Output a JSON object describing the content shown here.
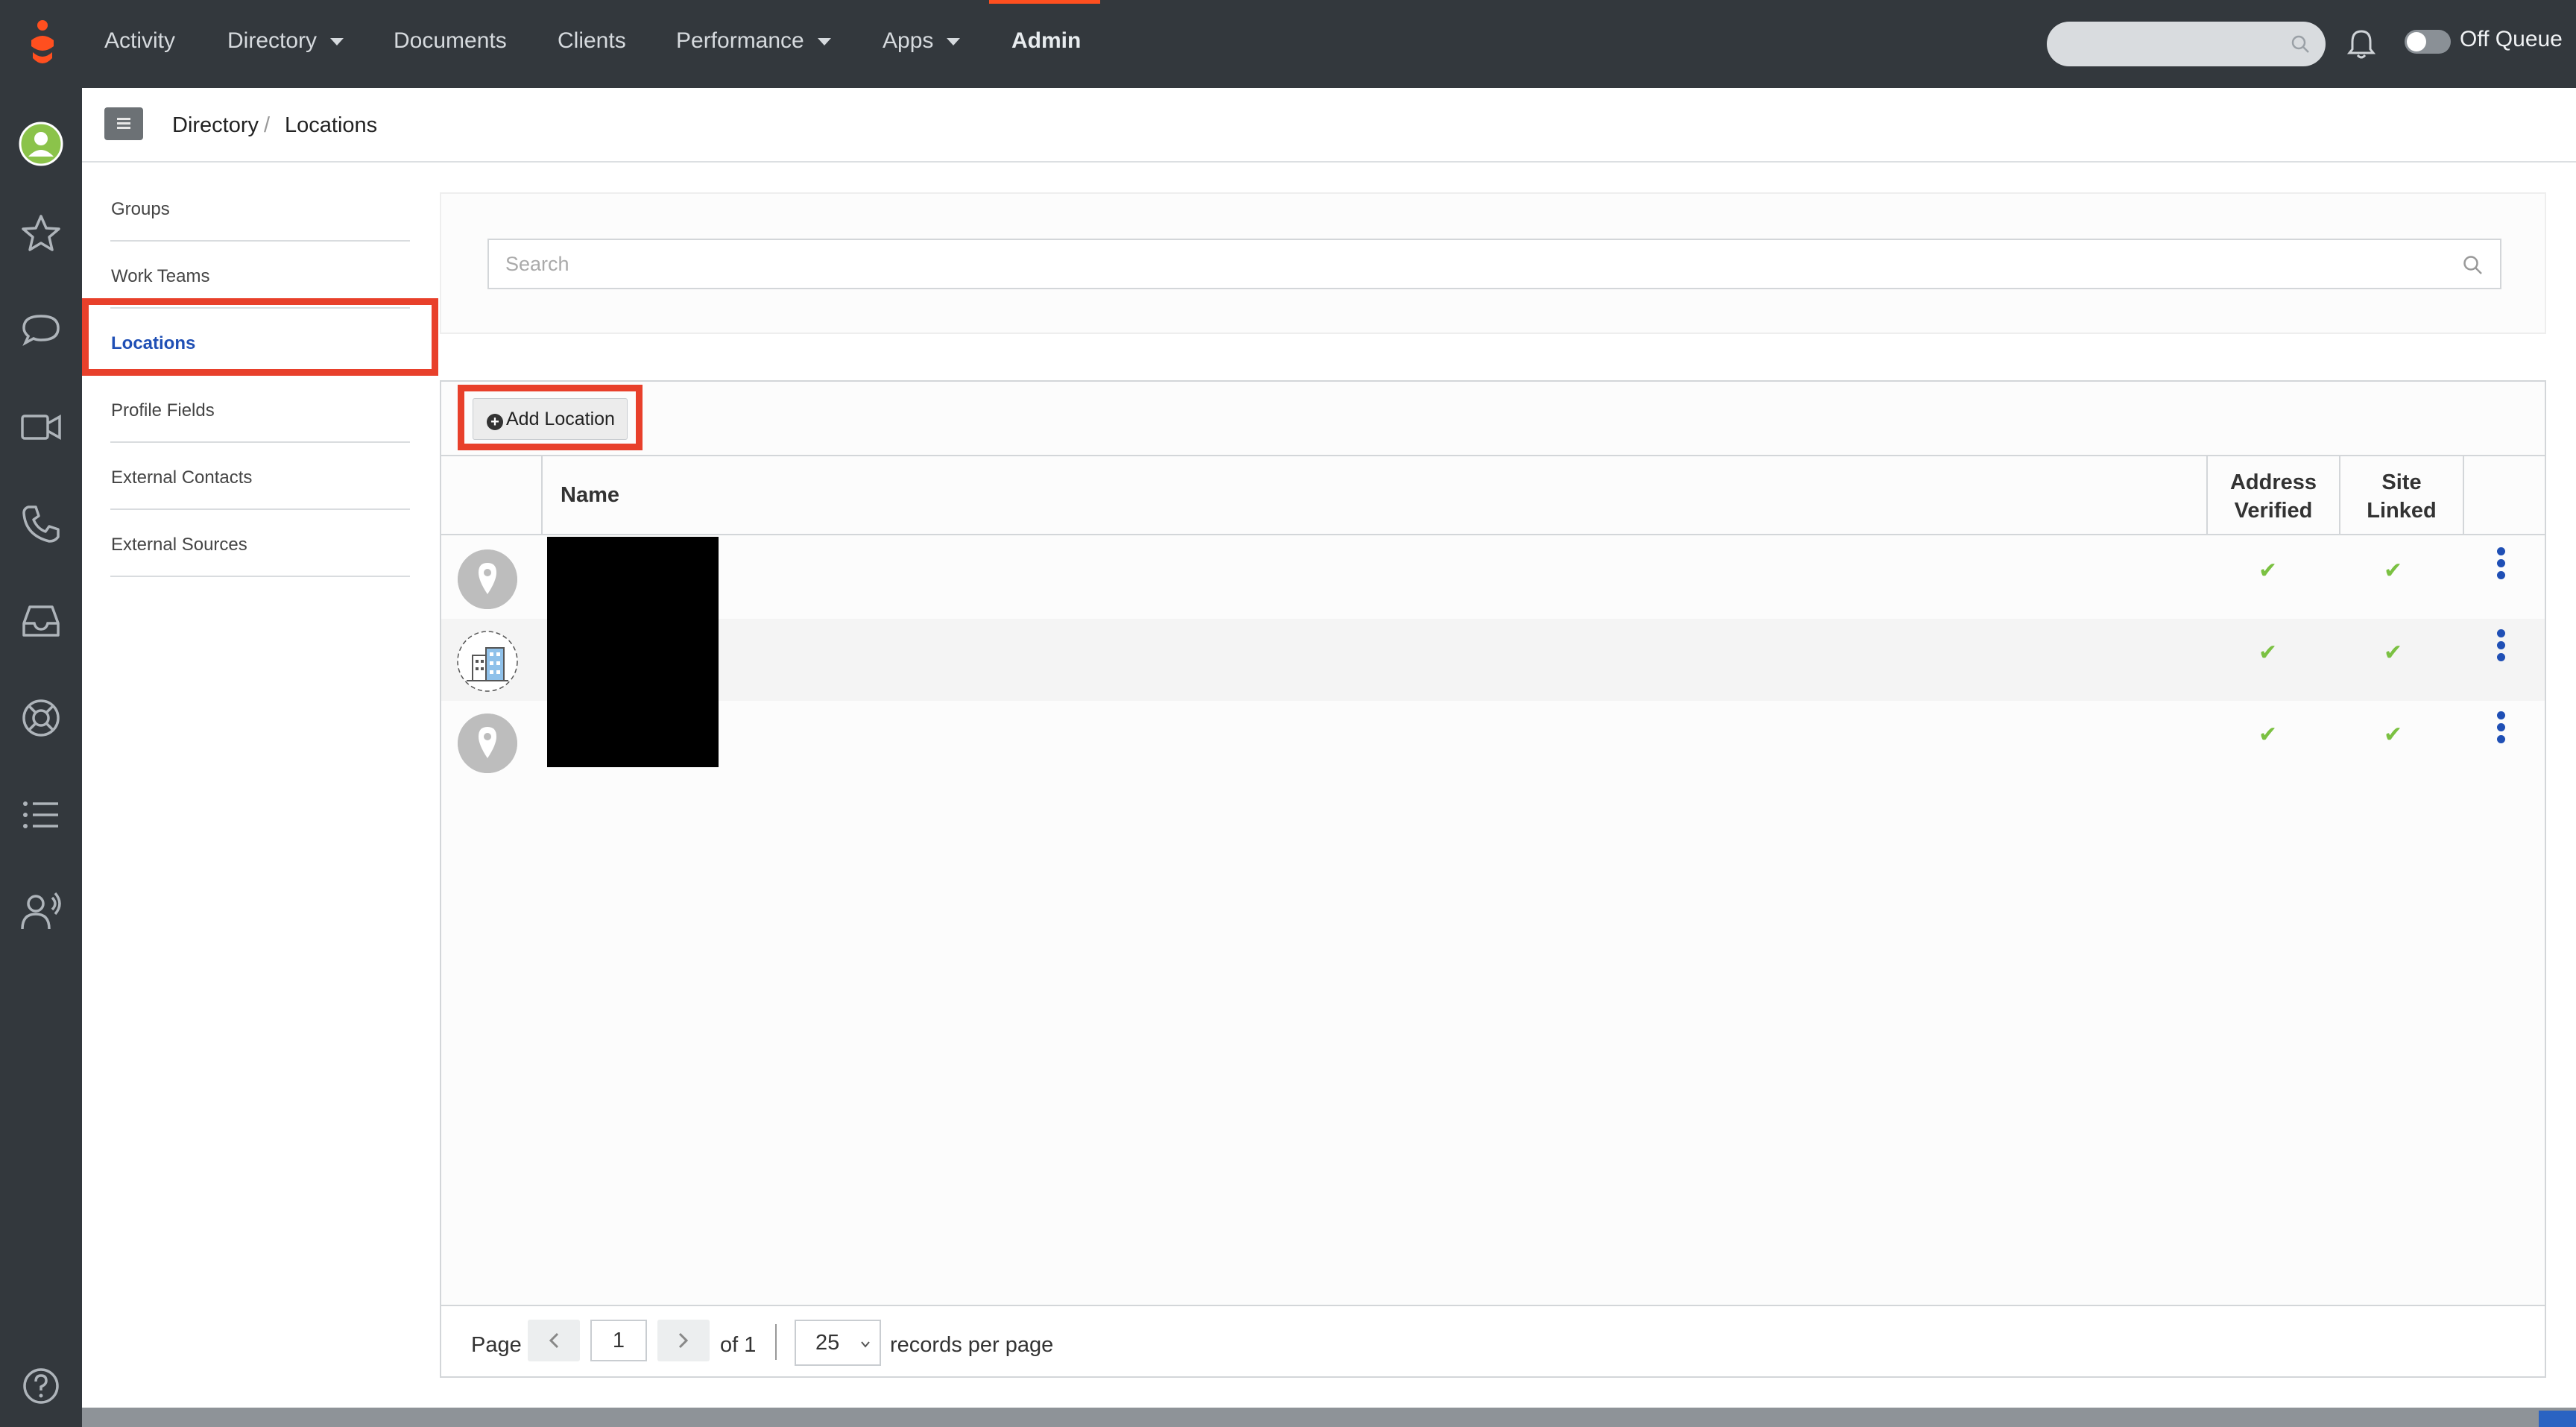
{
  "topnav": {
    "items": [
      {
        "label": "Activity",
        "has_caret": false
      },
      {
        "label": "Directory",
        "has_caret": true
      },
      {
        "label": "Documents",
        "has_caret": false
      },
      {
        "label": "Clients",
        "has_caret": false
      },
      {
        "label": "Performance",
        "has_caret": true
      },
      {
        "label": "Apps",
        "has_caret": true
      },
      {
        "label": "Admin",
        "has_caret": false,
        "active": true
      }
    ],
    "queue_label": "Off Queue",
    "accent_color": "#ff4f1f"
  },
  "rail": {
    "icons": [
      "avatar-icon",
      "star-icon",
      "chat-icon",
      "video-icon",
      "phone-icon",
      "inbox-icon",
      "lifebuoy-icon",
      "list-icon",
      "agent-icon",
      "help-icon"
    ]
  },
  "breadcrumb": {
    "items": [
      "Directory",
      "Locations"
    ],
    "separator": "/"
  },
  "sidebar": {
    "items": [
      {
        "label": "Groups"
      },
      {
        "label": "Work Teams"
      },
      {
        "label": "Locations",
        "active": true
      },
      {
        "label": "Profile Fields"
      },
      {
        "label": "External Contacts"
      },
      {
        "label": "External Sources"
      }
    ]
  },
  "search": {
    "placeholder": "Search"
  },
  "toolbar": {
    "add_label": "Add Location"
  },
  "table": {
    "columns": {
      "name": "Name",
      "address_verified": "Address\nVerified",
      "site_linked": "Site\nLinked"
    },
    "rows": [
      {
        "icon": "location-pin-icon",
        "address_verified": "✔",
        "site_linked": "✔"
      },
      {
        "icon": "building-icon",
        "address_verified": "✔",
        "site_linked": "✔"
      },
      {
        "icon": "location-pin-icon",
        "address_verified": "✔",
        "site_linked": "✔"
      }
    ]
  },
  "pagination": {
    "page_label": "Page",
    "current_page": "1",
    "of_label": "of 1",
    "per_page": "25",
    "per_page_label": "records per page"
  },
  "colors": {
    "highlight": "#e8402b",
    "link_active": "#1f4fb5",
    "check": "#7bc142"
  }
}
